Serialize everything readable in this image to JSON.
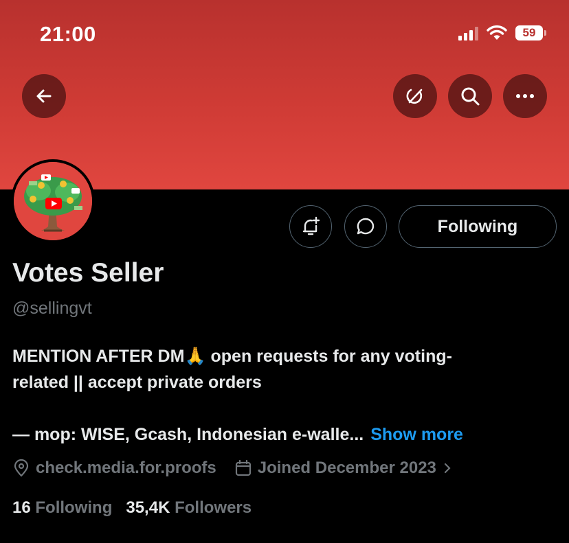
{
  "status_bar": {
    "time": "21:00",
    "battery": "59"
  },
  "profile": {
    "display_name": "Votes Seller",
    "handle": "@sellingvt",
    "bio_line1": "MENTION AFTER DM🙏 open requests for any voting-",
    "bio_line2": "related || accept private orders",
    "bio_line3": "— mop: WISE, Gcash, Indonesian e-walle...",
    "show_more": "Show more",
    "location": "check.media.for.proofs",
    "joined": "Joined December 2023",
    "following_count": "16",
    "following_label": "Following",
    "followers_count": "35,4K",
    "followers_label": "Followers"
  },
  "actions": {
    "follow_label": "Following"
  },
  "icons": {
    "back": "arrow-left-icon",
    "grok": "grok-icon",
    "search": "search-icon",
    "more": "more-icon",
    "notify": "bell-plus-icon",
    "message": "chat-bubble-icon",
    "location": "location-pin-icon",
    "calendar": "calendar-icon"
  },
  "colors": {
    "banner": "#cf3b35",
    "link": "#1d9bf0",
    "muted": "#71767b"
  }
}
